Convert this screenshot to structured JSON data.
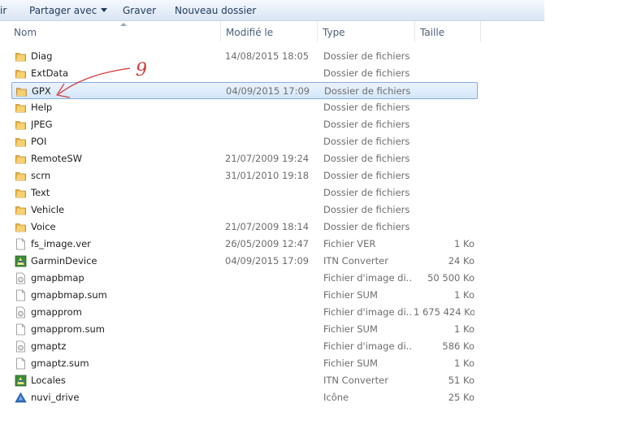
{
  "toolbar": {
    "cut_label": "ir",
    "share_label": "Partager avec",
    "burn_label": "Graver",
    "new_folder_label": "Nouveau dossier"
  },
  "columns": {
    "name": "Nom",
    "modified": "Modifié le",
    "type": "Type",
    "size": "Taille"
  },
  "annotation": {
    "number": "9"
  },
  "files": [
    {
      "name": "Diag",
      "date": "14/08/2015 18:05",
      "type": "Dossier de fichiers",
      "size": "",
      "icon": "folder-icon"
    },
    {
      "name": "ExtData",
      "date": "",
      "type": "Dossier de fichiers",
      "size": "",
      "icon": "folder-icon"
    },
    {
      "name": "GPX",
      "date": "04/09/2015 17:09",
      "type": "Dossier de fichiers",
      "size": "",
      "icon": "folder-icon",
      "selected": true
    },
    {
      "name": "Help",
      "date": "",
      "type": "Dossier de fichiers",
      "size": "",
      "icon": "folder-icon"
    },
    {
      "name": "JPEG",
      "date": "",
      "type": "Dossier de fichiers",
      "size": "",
      "icon": "folder-icon"
    },
    {
      "name": "POI",
      "date": "",
      "type": "Dossier de fichiers",
      "size": "",
      "icon": "folder-icon"
    },
    {
      "name": "RemoteSW",
      "date": "21/07/2009 19:24",
      "type": "Dossier de fichiers",
      "size": "",
      "icon": "folder-icon"
    },
    {
      "name": "scrn",
      "date": "31/01/2010 19:18",
      "type": "Dossier de fichiers",
      "size": "",
      "icon": "folder-icon"
    },
    {
      "name": "Text",
      "date": "",
      "type": "Dossier de fichiers",
      "size": "",
      "icon": "folder-icon"
    },
    {
      "name": "Vehicle",
      "date": "",
      "type": "Dossier de fichiers",
      "size": "",
      "icon": "folder-icon"
    },
    {
      "name": "Voice",
      "date": "21/07/2009 18:14",
      "type": "Dossier de fichiers",
      "size": "",
      "icon": "folder-icon"
    },
    {
      "name": "fs_image.ver",
      "date": "26/05/2009 12:47",
      "type": "Fichier VER",
      "size": "1 Ko",
      "icon": "file-icon"
    },
    {
      "name": "GarminDevice",
      "date": "04/09/2015 17:09",
      "type": "ITN Converter",
      "size": "24 Ko",
      "icon": "itn-converter-icon"
    },
    {
      "name": "gmapbmap",
      "date": "",
      "type": "Fichier d'image di...",
      "size": "50 500 Ko",
      "icon": "disk-image-icon"
    },
    {
      "name": "gmapbmap.sum",
      "date": "",
      "type": "Fichier SUM",
      "size": "1 Ko",
      "icon": "file-icon"
    },
    {
      "name": "gmapprom",
      "date": "",
      "type": "Fichier d'image di...",
      "size": "1 675 424 Ko",
      "icon": "disk-image-icon"
    },
    {
      "name": "gmapprom.sum",
      "date": "",
      "type": "Fichier SUM",
      "size": "1 Ko",
      "icon": "file-icon"
    },
    {
      "name": "gmaptz",
      "date": "",
      "type": "Fichier d'image di...",
      "size": "586 Ko",
      "icon": "disk-image-icon"
    },
    {
      "name": "gmaptz.sum",
      "date": "",
      "type": "Fichier SUM",
      "size": "1 Ko",
      "icon": "file-icon"
    },
    {
      "name": "Locales",
      "date": "",
      "type": "ITN Converter",
      "size": "51 Ko",
      "icon": "itn-converter-icon"
    },
    {
      "name": "nuvi_drive",
      "date": "",
      "type": "Icône",
      "size": "25 Ko",
      "icon": "drive-icon"
    }
  ]
}
